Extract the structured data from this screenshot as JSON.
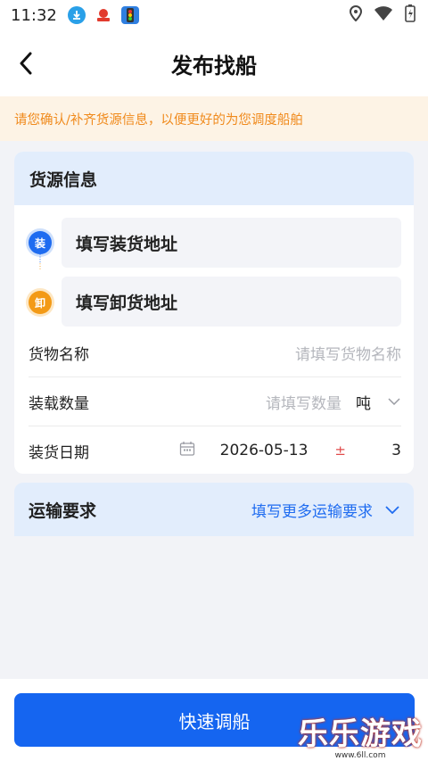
{
  "status_bar": {
    "time": "11:32",
    "left_icons": [
      "download-icon",
      "app-icon",
      "traffic-light-icon"
    ],
    "right_icons": [
      "location-icon",
      "wifi-icon",
      "battery-icon"
    ]
  },
  "header": {
    "title": "发布找船"
  },
  "notice": {
    "text": "请您确认/补齐货源信息，以便更好的为您调度船舶"
  },
  "cargo_card": {
    "title": "货源信息",
    "load_address": {
      "badge": "装",
      "placeholder": "填写装货地址"
    },
    "unload_address": {
      "badge": "卸",
      "placeholder": "填写卸货地址"
    },
    "goods_name": {
      "label": "货物名称",
      "placeholder": "请填写货物名称"
    },
    "quantity": {
      "label": "装载数量",
      "placeholder": "请填写数量",
      "unit": "吨"
    },
    "load_date": {
      "label": "装货日期",
      "date": "2026-05-13",
      "plus_minus": "±",
      "days": "3"
    }
  },
  "transport_card": {
    "title": "运输要求",
    "more": "填写更多运输要求"
  },
  "submit": {
    "label": "快速调船"
  },
  "watermark": {
    "text": "乐乐游戏",
    "url": "www.6ll.com"
  },
  "colors": {
    "primary": "#1565f0",
    "notice_bg": "#fdf3e5",
    "notice_text": "#f08a1c",
    "card_header_bg": "#e2edfc",
    "badge_unload": "#f39a16"
  }
}
